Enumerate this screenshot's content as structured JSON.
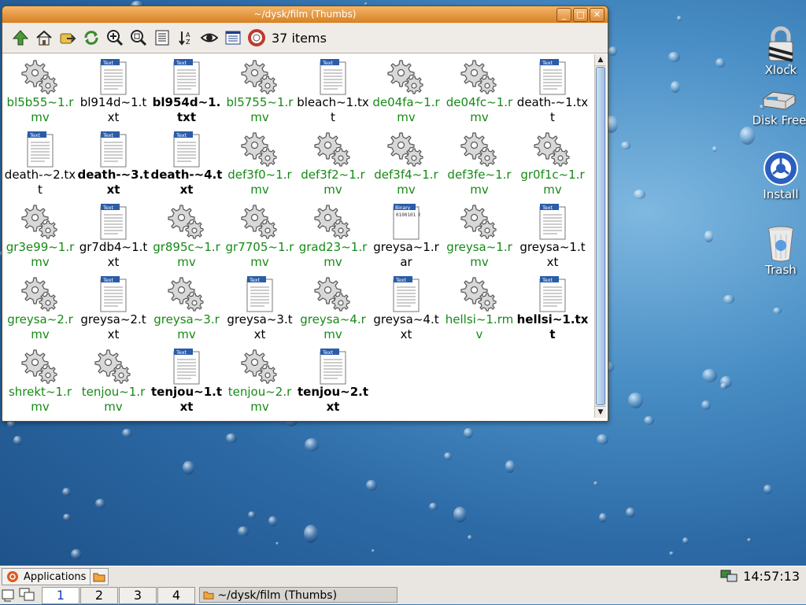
{
  "window": {
    "title": "~/dysk/film (Thumbs)",
    "item_count": "37 items",
    "buttons": {
      "minimize": "_",
      "maximize": "□",
      "close": "✕"
    }
  },
  "files": [
    {
      "name": "bl5b55~1.rmv",
      "type": "rmv",
      "bold": false
    },
    {
      "name": "bl914d~1.txt",
      "type": "txt",
      "bold": false
    },
    {
      "name": "bl954d~1.txt",
      "type": "txt",
      "bold": true
    },
    {
      "name": "bl5755~1.rmv",
      "type": "rmv",
      "bold": false
    },
    {
      "name": "bleach~1.txt",
      "type": "txt",
      "bold": false
    },
    {
      "name": "de04fa~1.rmv",
      "type": "rmv",
      "bold": false
    },
    {
      "name": "de04fc~1.rmv",
      "type": "rmv",
      "bold": false
    },
    {
      "name": "death-~1.txt",
      "type": "txt",
      "bold": false
    },
    {
      "name": "death-~2.txt",
      "type": "txt",
      "bold": false
    },
    {
      "name": "death-~3.txt",
      "type": "txt",
      "bold": true
    },
    {
      "name": "death-~4.txt",
      "type": "txt",
      "bold": true
    },
    {
      "name": "def3f0~1.rmv",
      "type": "rmv",
      "bold": false
    },
    {
      "name": "def3f2~1.rmv",
      "type": "rmv",
      "bold": false
    },
    {
      "name": "def3f4~1.rmv",
      "type": "rmv",
      "bold": false
    },
    {
      "name": "def3fe~1.rmv",
      "type": "rmv",
      "bold": false
    },
    {
      "name": "gr0f1c~1.rmv",
      "type": "rmv",
      "bold": false
    },
    {
      "name": "gr3e99~1.rmv",
      "type": "rmv",
      "bold": false
    },
    {
      "name": "gr7db4~1.txt",
      "type": "txt",
      "bold": false
    },
    {
      "name": "gr895c~1.rmv",
      "type": "rmv",
      "bold": false
    },
    {
      "name": "gr7705~1.rmv",
      "type": "rmv",
      "bold": false
    },
    {
      "name": "grad23~1.rmv",
      "type": "rmv",
      "bold": false
    },
    {
      "name": "greysa~1.rar",
      "type": "rar",
      "bold": false
    },
    {
      "name": "greysa~1.rmv",
      "type": "rmv",
      "bold": false
    },
    {
      "name": "greysa~1.txt",
      "type": "txt",
      "bold": false
    },
    {
      "name": "greysa~2.rmv",
      "type": "rmv",
      "bold": false
    },
    {
      "name": "greysa~2.txt",
      "type": "txt",
      "bold": false
    },
    {
      "name": "greysa~3.rmv",
      "type": "rmv",
      "bold": false
    },
    {
      "name": "greysa~3.txt",
      "type": "txt",
      "bold": false
    },
    {
      "name": "greysa~4.rmv",
      "type": "rmv",
      "bold": false
    },
    {
      "name": "greysa~4.txt",
      "type": "txt",
      "bold": false
    },
    {
      "name": "hellsi~1.rmv",
      "type": "rmv",
      "bold": false
    },
    {
      "name": "hellsi~1.txt",
      "type": "txt",
      "bold": true
    },
    {
      "name": "shrekt~1.rmv",
      "type": "rmv",
      "bold": false
    },
    {
      "name": "tenjou~1.rmv",
      "type": "rmv",
      "bold": false
    },
    {
      "name": "tenjou~1.txt",
      "type": "txt",
      "bold": true
    },
    {
      "name": "tenjou~2.rmv",
      "type": "rmv",
      "bold": false
    },
    {
      "name": "tenjou~2.txt",
      "type": "txt",
      "bold": true
    }
  ],
  "desktop_icons": [
    {
      "label": "Xlock",
      "icon": "lock-icon"
    },
    {
      "label": "Disk Free",
      "icon": "disk-icon"
    },
    {
      "label": "Install",
      "icon": "install-icon"
    },
    {
      "label": "Trash",
      "icon": "trash-icon"
    }
  ],
  "panel": {
    "applications_label": "Applications",
    "clock": "14:57:13",
    "workspaces": [
      "1",
      "2",
      "3",
      "4"
    ],
    "active_workspace": "1",
    "task_label": "~/dysk/film (Thumbs)"
  },
  "icon_text": {
    "text_badge": "Text",
    "binary_badge": "Binary",
    "binary_lines": "0100101 0011100 1011101 1110001"
  },
  "colors": {
    "rmv_label": "#168a16",
    "titlebar": "#e08a2c",
    "active_workspace": "#1a3fbf"
  }
}
